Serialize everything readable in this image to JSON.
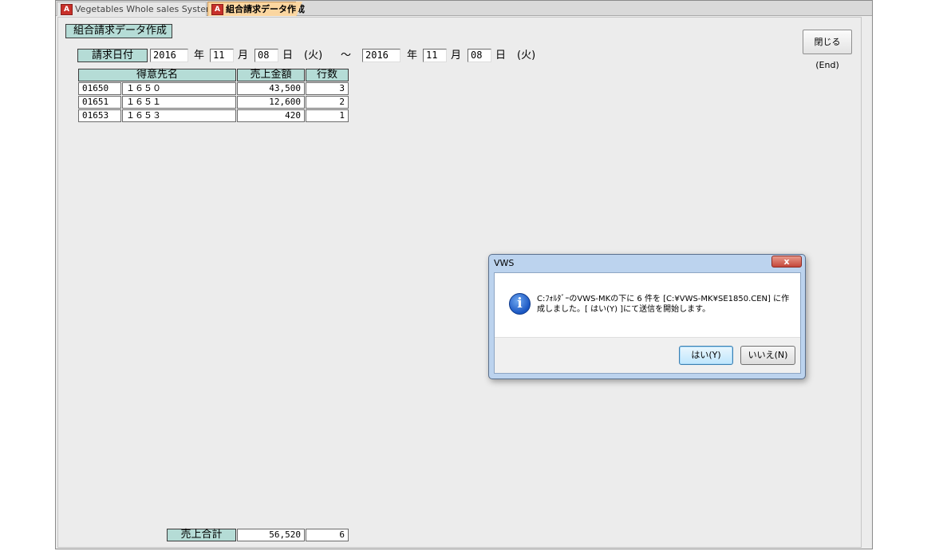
{
  "tabs": [
    {
      "label": "Vegetables Whole sales System",
      "active": false
    },
    {
      "label": "組合請求データ作成",
      "active": true
    }
  ],
  "form": {
    "title": "組合請求データ作成",
    "close_button": "閉じる(End)",
    "date_label": "請求日付",
    "from": {
      "year": "2016",
      "month": "11",
      "day": "08",
      "weekday": "(火)"
    },
    "to": {
      "year": "2016",
      "month": "11",
      "day": "08",
      "weekday": "(火)"
    },
    "unit_year": "年",
    "unit_month": "月",
    "unit_day": "日",
    "range_sep": "～"
  },
  "table": {
    "headers": [
      "得意先名",
      "売上金額",
      "行数"
    ],
    "rows": [
      {
        "code": "01650",
        "name": "１６５０",
        "amount": "43,500",
        "lines": "3"
      },
      {
        "code": "01651",
        "name": "１６５１",
        "amount": "12,600",
        "lines": "2"
      },
      {
        "code": "01653",
        "name": "１６５３",
        "amount": "420",
        "lines": "1"
      }
    ]
  },
  "totals": {
    "label": "売上合計",
    "amount": "56,520",
    "lines": "6"
  },
  "dialog": {
    "title": "VWS",
    "close_glyph": "x",
    "icon_glyph": "i",
    "message_line1": "C:ﾌｫﾙﾀﾞｰのVWS-MKの下に 6 件を [C:¥VWS-MK¥SE1850.CEN] に作",
    "message_line2": "成しました。[ はい(Y) ]にて送信を開始します。",
    "yes_button": "はい(Y)",
    "no_button": "いいえ(N)"
  },
  "colors": {
    "label_bg": "#b5dcd6",
    "active_tab": "#fbd6a0",
    "dialog_frame": "#bcd3ee"
  },
  "icons": {
    "tab_icon": "access-form-icon",
    "info": "info-icon",
    "close": "close-icon"
  }
}
